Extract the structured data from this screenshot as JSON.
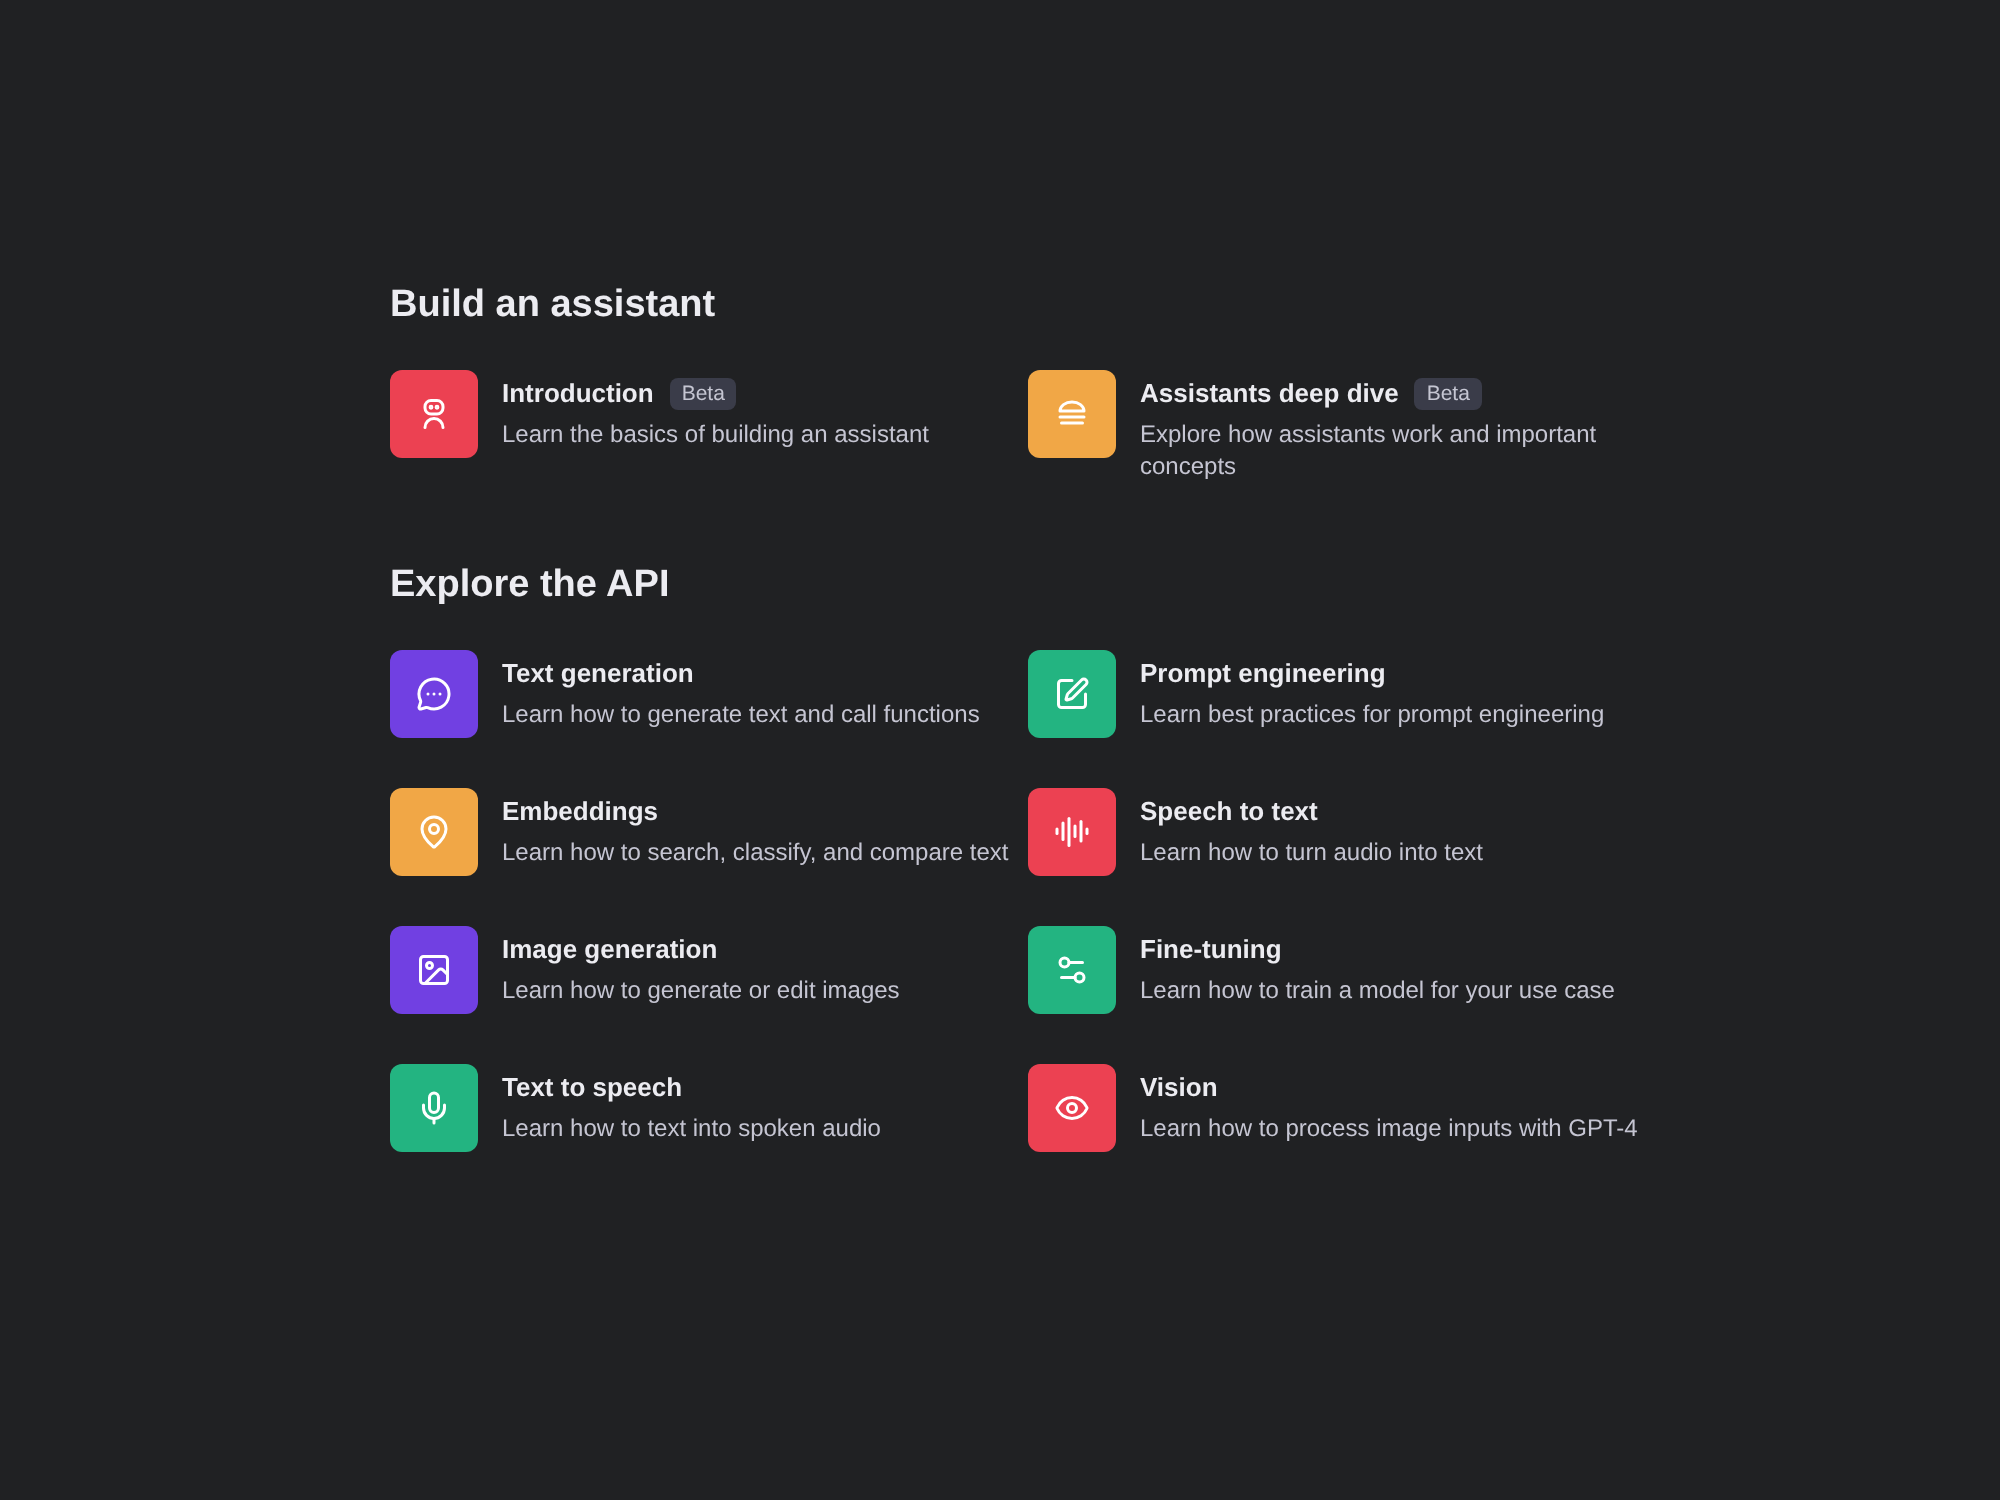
{
  "sections": [
    {
      "title": "Build an assistant",
      "items": [
        {
          "title": "Introduction",
          "badge": "Beta",
          "description": "Learn the basics of building an assistant",
          "color": "#ec4152"
        },
        {
          "title": "Assistants deep dive",
          "badge": "Beta",
          "description": "Explore how assistants work and important concepts",
          "color": "#f1a746"
        }
      ]
    },
    {
      "title": "Explore the API",
      "items": [
        {
          "title": "Text generation",
          "description": "Learn how to generate text and call functions",
          "color": "#7140e2"
        },
        {
          "title": "Prompt engineering",
          "description": "Learn best practices for prompt engineering",
          "color": "#23b481"
        },
        {
          "title": "Embeddings",
          "description": "Learn how to search, classify, and compare text",
          "color": "#f1a746"
        },
        {
          "title": "Speech to text",
          "description": "Learn how to turn audio into text",
          "color": "#ec4152"
        },
        {
          "title": "Image generation",
          "description": "Learn how to generate or edit images",
          "color": "#7140e2"
        },
        {
          "title": "Fine-tuning",
          "description": "Learn how to train a model for your use case",
          "color": "#23b481"
        },
        {
          "title": "Text to speech",
          "description": "Learn how to text into spoken audio",
          "color": "#23b481"
        },
        {
          "title": "Vision",
          "description": "Learn how to process image inputs with GPT-4",
          "color": "#ec4152"
        }
      ]
    }
  ]
}
